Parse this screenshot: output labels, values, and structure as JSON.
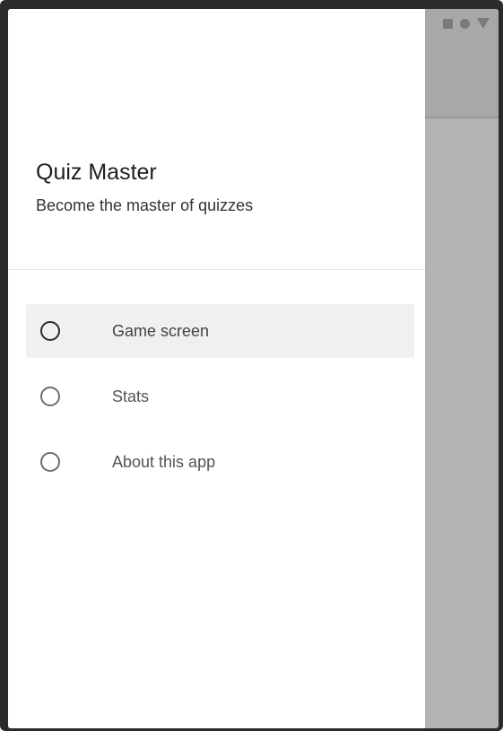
{
  "drawer": {
    "title": "Quiz Master",
    "subtitle": "Become the master of quizzes"
  },
  "menu": {
    "items": [
      {
        "label": "Game screen",
        "icon": "radio-unchecked-icon",
        "selected": true
      },
      {
        "label": "Stats",
        "icon": "radio-unchecked-icon",
        "selected": false
      },
      {
        "label": "About this app",
        "icon": "radio-unchecked-icon",
        "selected": false
      }
    ]
  },
  "status_bar": {
    "icons": [
      "square-icon",
      "circle-icon",
      "triangle-icon"
    ]
  },
  "colors": {
    "scrim": "#b3b3b3",
    "drawer_bg": "#ffffff",
    "selected_bg": "#f0f0f0"
  }
}
